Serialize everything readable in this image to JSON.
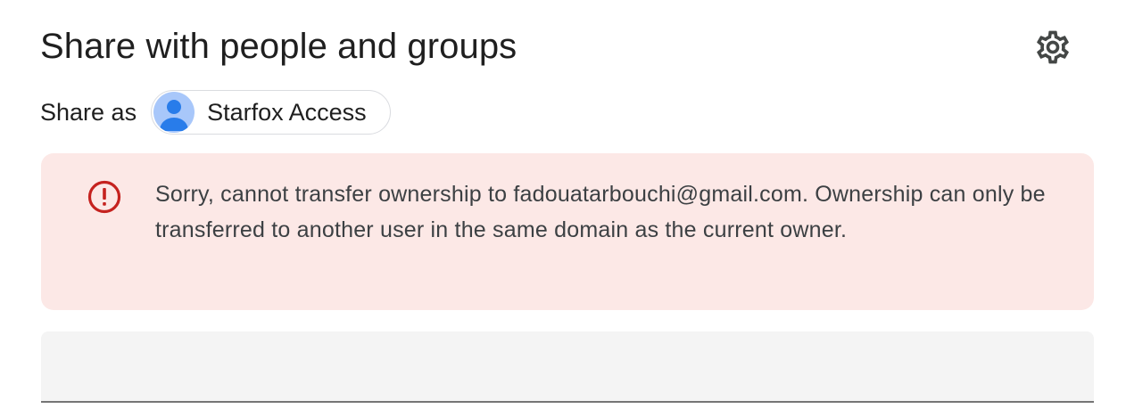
{
  "dialog": {
    "title": "Share with people and groups",
    "settings_icon": "gear-icon"
  },
  "share_as": {
    "label": "Share as",
    "account_name": "Starfox Access",
    "avatar_icon": "person-icon"
  },
  "error": {
    "icon": "error-circle-icon",
    "message": "Sorry, cannot transfer ownership to fadouatarbouchi@gmail.com. Ownership can only be transferred to another user in the same domain as the current owner.",
    "background_color": "#fce8e6",
    "icon_color": "#c5221f"
  },
  "add_people_input": {
    "value": ""
  }
}
